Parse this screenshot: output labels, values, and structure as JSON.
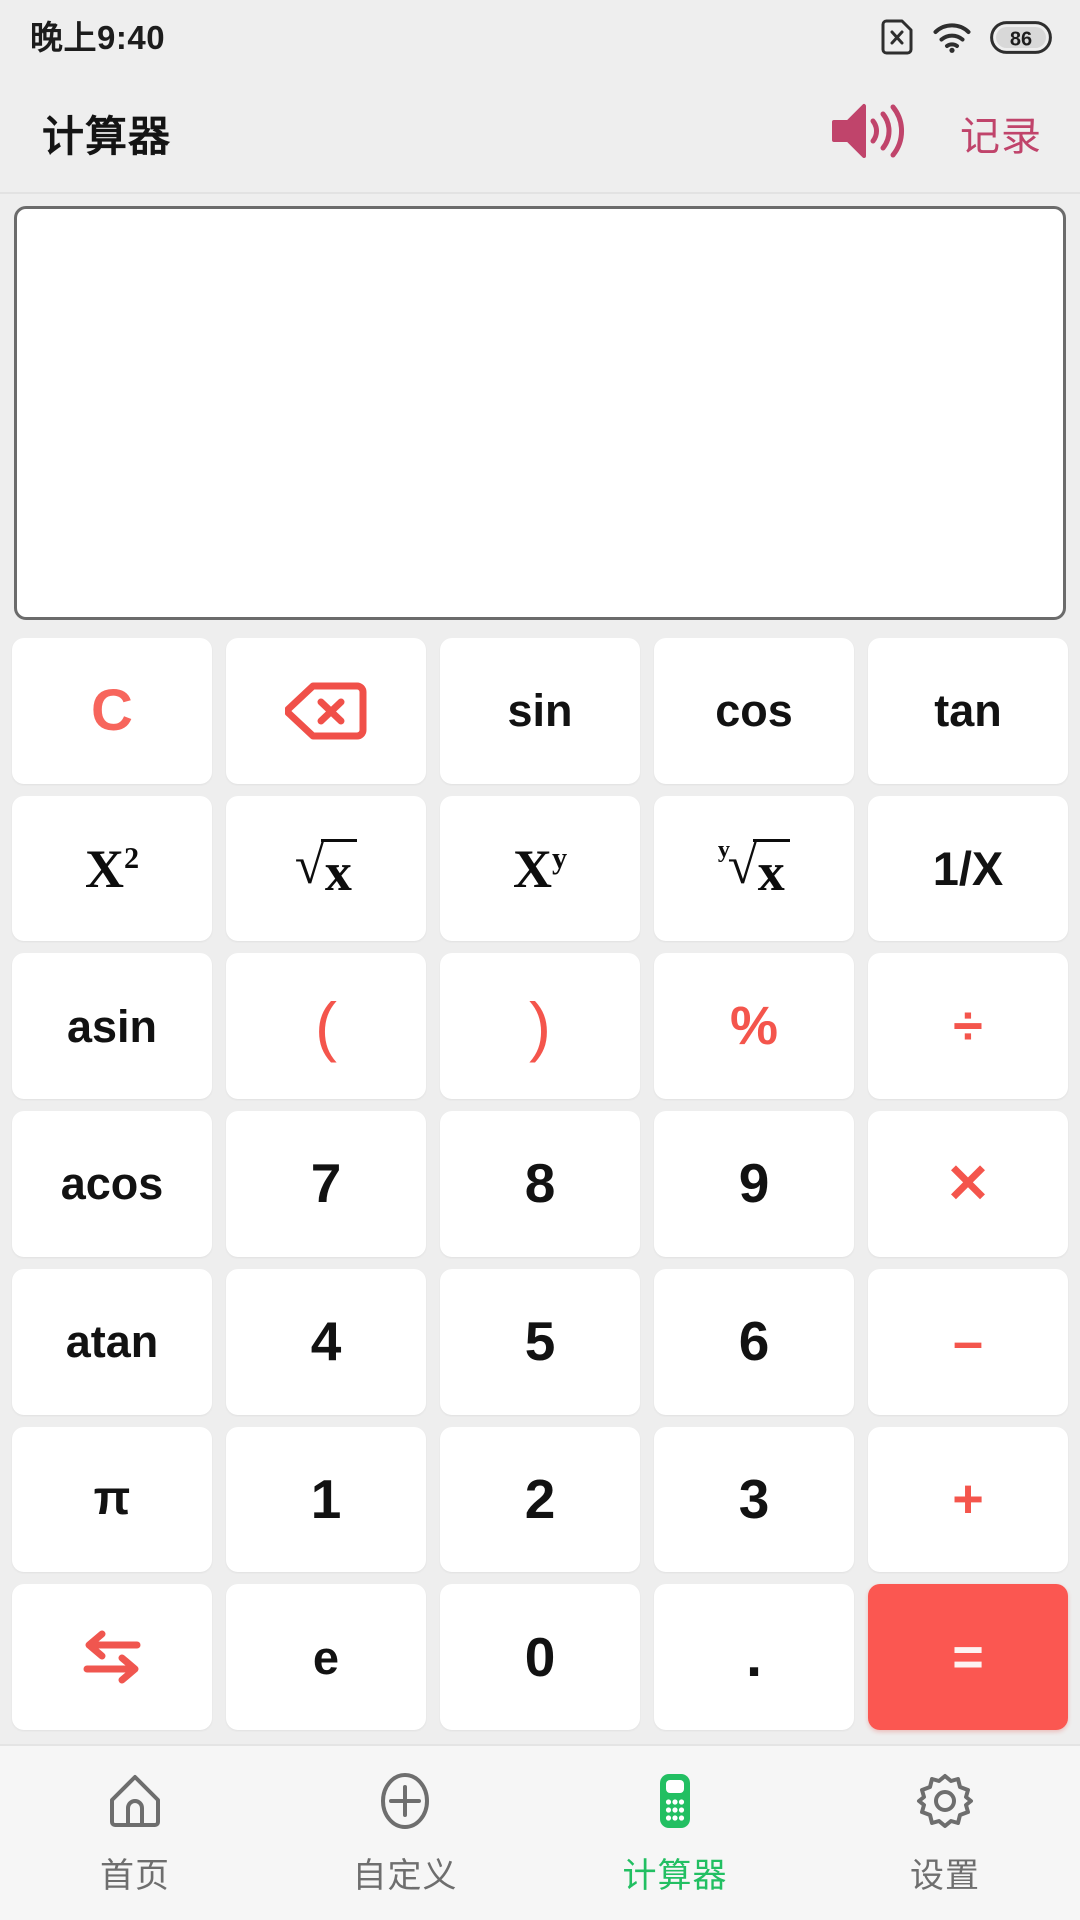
{
  "status_bar": {
    "time": "晚上9:40",
    "sim_icon": "sim-card-off-icon",
    "wifi_icon": "wifi-icon",
    "battery_icon": "battery-icon",
    "battery_level": "86"
  },
  "header": {
    "title": "计算器",
    "speaker_icon": "speaker-volume-icon",
    "records_label": "记录",
    "accent_color": "#c0446b"
  },
  "display": {
    "value": "",
    "placeholder": ""
  },
  "keypad": {
    "accent_color": "#f4554c",
    "equals_color": "#fb5751",
    "keys": [
      {
        "id": "clear",
        "label": "C",
        "style": "accent-clear",
        "name": "key-clear"
      },
      {
        "id": "backspace",
        "label": "",
        "style": "icon",
        "name": "key-backspace",
        "icon": "backspace-icon"
      },
      {
        "id": "sin",
        "label": "sin",
        "style": "fn-word",
        "name": "key-sin"
      },
      {
        "id": "cos",
        "label": "cos",
        "style": "fn-word",
        "name": "key-cos"
      },
      {
        "id": "tan",
        "label": "tan",
        "style": "fn-word",
        "name": "key-tan"
      },
      {
        "id": "square",
        "label": "X²",
        "style": "math",
        "name": "key-x-squared"
      },
      {
        "id": "sqrt",
        "label": "√x",
        "style": "math",
        "name": "key-square-root"
      },
      {
        "id": "power",
        "label": "Xʸ",
        "style": "math",
        "name": "key-x-power-y"
      },
      {
        "id": "yroot",
        "label": "ʸ√x",
        "style": "math",
        "name": "key-y-root-x"
      },
      {
        "id": "reciprocal",
        "label": "1/X",
        "style": "plain",
        "name": "key-reciprocal"
      },
      {
        "id": "asin",
        "label": "asin",
        "style": "fn-word",
        "name": "key-asin"
      },
      {
        "id": "lparen",
        "label": "(",
        "style": "paren",
        "name": "key-left-paren"
      },
      {
        "id": "rparen",
        "label": ")",
        "style": "paren",
        "name": "key-right-paren"
      },
      {
        "id": "percent",
        "label": "%",
        "style": "op-sym",
        "name": "key-percent"
      },
      {
        "id": "divide",
        "label": "÷",
        "style": "op-sym",
        "name": "key-divide"
      },
      {
        "id": "acos",
        "label": "acos",
        "style": "fn-word",
        "name": "key-acos"
      },
      {
        "id": "seven",
        "label": "7",
        "style": "digit",
        "name": "key-7"
      },
      {
        "id": "eight",
        "label": "8",
        "style": "digit",
        "name": "key-8"
      },
      {
        "id": "nine",
        "label": "9",
        "style": "digit",
        "name": "key-9"
      },
      {
        "id": "multiply",
        "label": "✕",
        "style": "op-sym",
        "name": "key-multiply"
      },
      {
        "id": "atan",
        "label": "atan",
        "style": "fn-word",
        "name": "key-atan"
      },
      {
        "id": "four",
        "label": "4",
        "style": "digit",
        "name": "key-4"
      },
      {
        "id": "five",
        "label": "5",
        "style": "digit",
        "name": "key-5"
      },
      {
        "id": "six",
        "label": "6",
        "style": "digit",
        "name": "key-6"
      },
      {
        "id": "minus",
        "label": "–",
        "style": "op-sym",
        "name": "key-minus"
      },
      {
        "id": "pi",
        "label": "π",
        "style": "pi",
        "name": "key-pi"
      },
      {
        "id": "one",
        "label": "1",
        "style": "digit",
        "name": "key-1"
      },
      {
        "id": "two",
        "label": "2",
        "style": "digit",
        "name": "key-2"
      },
      {
        "id": "three",
        "label": "3",
        "style": "digit",
        "name": "key-3"
      },
      {
        "id": "plus",
        "label": "+",
        "style": "op-sym",
        "name": "key-plus"
      },
      {
        "id": "swap",
        "label": "",
        "style": "icon",
        "name": "key-swap",
        "icon": "swap-arrows-icon"
      },
      {
        "id": "e",
        "label": "e",
        "style": "plain",
        "name": "key-e"
      },
      {
        "id": "zero",
        "label": "0",
        "style": "digit",
        "name": "key-0"
      },
      {
        "id": "decimal",
        "label": ".",
        "style": "dot",
        "name": "key-decimal"
      },
      {
        "id": "equals",
        "label": "=",
        "style": "equals",
        "name": "key-equals"
      }
    ]
  },
  "bottom_nav": {
    "active_color": "#22bf62",
    "inactive_color": "#6e6e6e",
    "items": [
      {
        "label": "首页",
        "icon": "home-icon",
        "name": "nav-item-home",
        "active": false
      },
      {
        "label": "自定义",
        "icon": "plus-circle-icon",
        "name": "nav-item-custom",
        "active": false
      },
      {
        "label": "计算器",
        "icon": "calculator-icon",
        "name": "nav-item-calculator",
        "active": true
      },
      {
        "label": "设置",
        "icon": "gear-icon",
        "name": "nav-item-settings",
        "active": false
      }
    ]
  }
}
